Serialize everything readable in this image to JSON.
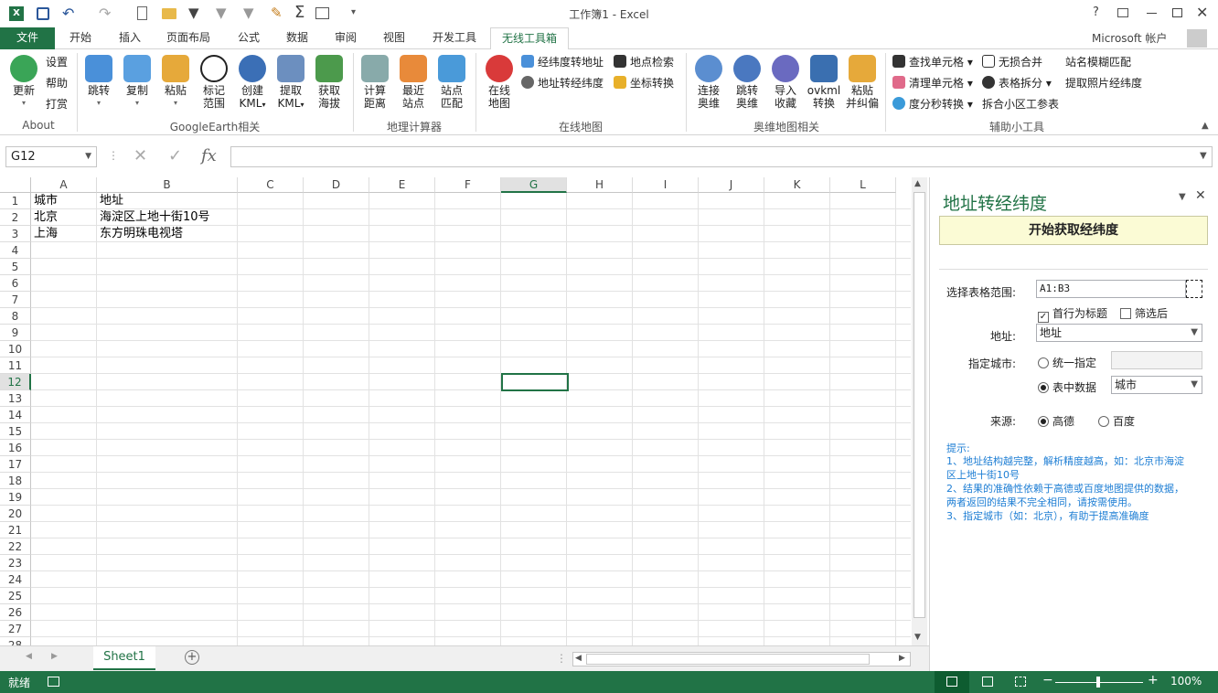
{
  "window": {
    "title": "工作簿1 - Excel",
    "account": "Microsoft 帐户"
  },
  "tabs": [
    "文件",
    "开始",
    "插入",
    "页面布局",
    "公式",
    "数据",
    "审阅",
    "视图",
    "开发工具",
    "无线工具箱"
  ],
  "active_tab": "无线工具箱",
  "ribbon": {
    "about": {
      "update": "更新",
      "settings": "设置",
      "help": "帮助",
      "tip": "打赏",
      "label": "About"
    },
    "ge": {
      "goto": "跳转",
      "copy": "复制",
      "paste": "粘贴",
      "mark1": "标记",
      "mark2": "范围",
      "create1": "创建",
      "create2": "KML",
      "extract1": "提取",
      "extract2": "KML",
      "alt1": "获取",
      "alt2": "海拔",
      "label": "GoogleEarth相关"
    },
    "geo": {
      "dist1": "计算",
      "dist2": "距离",
      "near1": "最近",
      "near2": "站点",
      "match1": "站点",
      "match2": "匹配",
      "label": "地理计算器"
    },
    "online": {
      "map1": "在线",
      "map2": "地图",
      "ll2addr": "经纬度转地址",
      "addr2ll": "地址转经纬度",
      "search": "地点检索",
      "coord": "坐标转换",
      "label": "在线地图"
    },
    "ovi": {
      "connect1": "连接",
      "connect2": "奥维",
      "jump1": "跳转",
      "jump2": "奥维",
      "import1": "导入",
      "import2": "收藏",
      "ovkml1": "ovkml",
      "ovkml2": "转换",
      "paste1": "粘贴",
      "paste2": "并纠偏",
      "label": "奥维地图相关"
    },
    "aux": {
      "find": "查找单元格",
      "clear": "清理单元格",
      "dms": "度分秒转换",
      "merge": "无损合并",
      "split": "表格拆分",
      "mergecell": "拆合小区工参表",
      "fuzzy": "站名模糊匹配",
      "photo": "提取照片经纬度",
      "label": "辅助小工具"
    }
  },
  "formula_bar": {
    "name_box": "G12",
    "formula": ""
  },
  "columns": [
    "A",
    "B",
    "C",
    "D",
    "E",
    "F",
    "G",
    "H",
    "I",
    "J",
    "K",
    "L"
  ],
  "rows": [
    "1",
    "2",
    "3",
    "4",
    "5",
    "6",
    "7",
    "8",
    "9",
    "10",
    "11",
    "12",
    "13",
    "14",
    "15",
    "16",
    "17",
    "18",
    "19",
    "20",
    "21",
    "22",
    "23",
    "24",
    "25",
    "26",
    "27",
    "28"
  ],
  "cells": [
    {
      "a": "城市",
      "b": "地址"
    },
    {
      "a": "北京",
      "b": "海淀区上地十街10号"
    },
    {
      "a": "上海",
      "b": "东方明珠电视塔"
    }
  ],
  "sheet_tab": "Sheet1",
  "pane": {
    "title": "地址转经纬度",
    "start_button": "开始获取经纬度",
    "range_label": "选择表格范围:",
    "range_value": "A1:B3",
    "header_check": "首行为标题",
    "filtered_check": "筛选后",
    "address_label": "地址:",
    "address_value": "地址",
    "city_label": "指定城市:",
    "city_opt1": "统一指定",
    "city_opt2": "表中数据",
    "city_value": "城市",
    "source_label": "来源:",
    "source_opt1": "高德",
    "source_opt2": "百度",
    "tips_title": "提示:",
    "tip1": "1、地址结构越完整，解析精度越高，如：北京市海淀区上地十街10号",
    "tip2": "2、结果的准确性依赖于高德或百度地图提供的数据，两者返回的结果不完全相同，请按需使用。",
    "tip3": "3、指定城市（如：北京），有助于提高准确度"
  },
  "status": {
    "ready": "就绪",
    "zoom": "100%"
  }
}
